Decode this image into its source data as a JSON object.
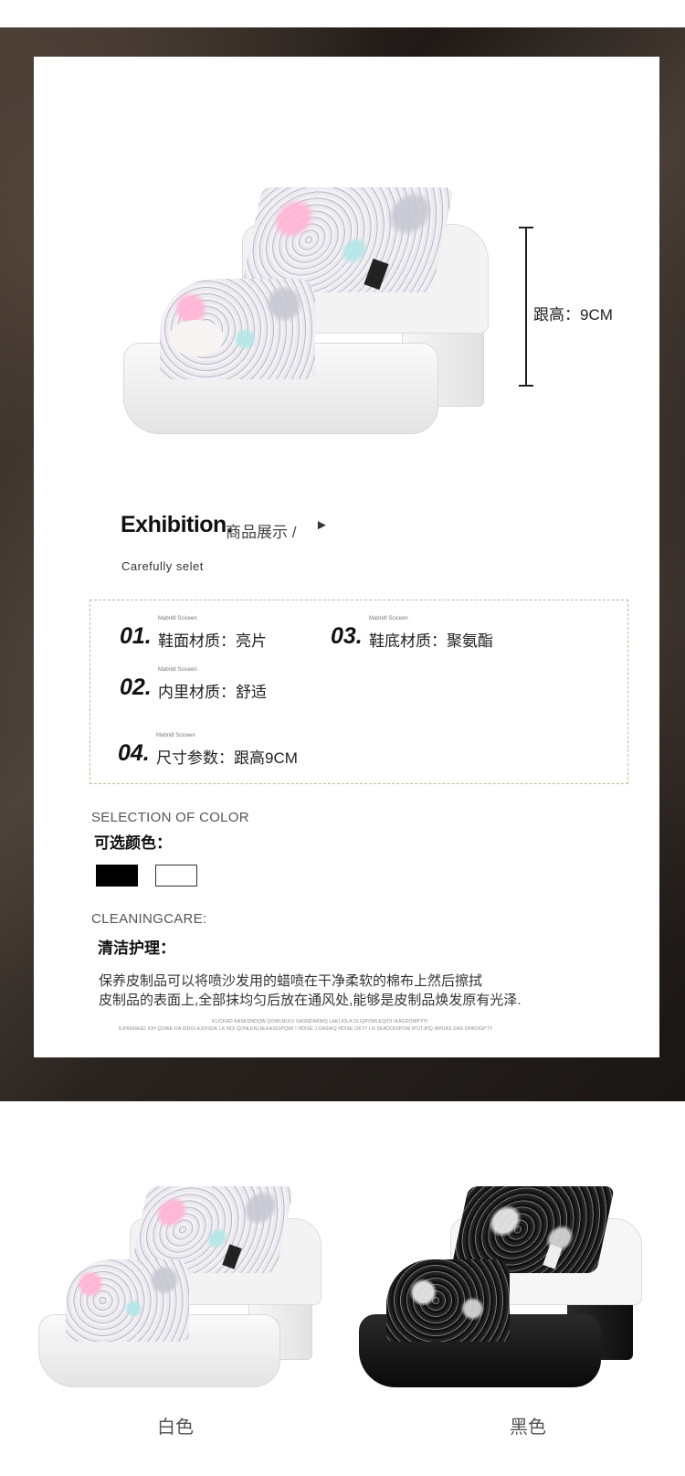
{
  "hero": {
    "heel_height_label": "跟高：9CM"
  },
  "exhibition": {
    "title": "Exhibition.",
    "title_cn": "商品展示 /",
    "arrow": "►",
    "subtitle": "Carefully selet"
  },
  "specs": [
    {
      "num": "01.",
      "brand": "Mabridl Sciceen",
      "label": "鞋面材质",
      "value": "：亮片"
    },
    {
      "num": "03.",
      "brand": "Mabridl Sciceen",
      "label": "鞋底材质",
      "value": "：聚氨酯"
    },
    {
      "num": "02.",
      "brand": "Mabridl Sciceen",
      "label": "内里材质",
      "value": "：舒适"
    },
    {
      "num": "04.",
      "brand": "Mabridl Sciceen",
      "label": "尺寸参数",
      "value": "：跟高9CM"
    }
  ],
  "color_selection": {
    "title": "SELECTION OF COLOR",
    "title_cn": "可选颜色：",
    "swatches": [
      {
        "name": "black",
        "color": "#000000"
      },
      {
        "name": "white",
        "color": "#ffffff"
      }
    ]
  },
  "care": {
    "title": "CLEANINGCARE:",
    "title_cn": "清洁护理：",
    "lines": [
      "保养皮制品可以将喷沙发用的蜡喷在干净柔软的棉布上然后擦拭",
      "皮制品的表面上,全部抹均匀后放在通风处,能够是皮制品焕发原有光泽."
    ],
    "tiny_lines": [
      "KLICKAD KASKDNDQW QOWLNLKV OASNDAKWQ LAKLIOLA DLIQPOMLKQIOI IKAGDOWPYYI",
      "KJHIKNASD IOH QOWE OA ISDOI AJOISDK LK NOI QONLKNLNLKASIOPQWI I HDISE J OASWQ HDISE OKTY LN SKADOIOPOW IPOTJHQ WPDAS DAS DPAOIGPTY"
    ]
  },
  "variants": [
    {
      "label": "白色"
    },
    {
      "label": "黑色"
    }
  ]
}
